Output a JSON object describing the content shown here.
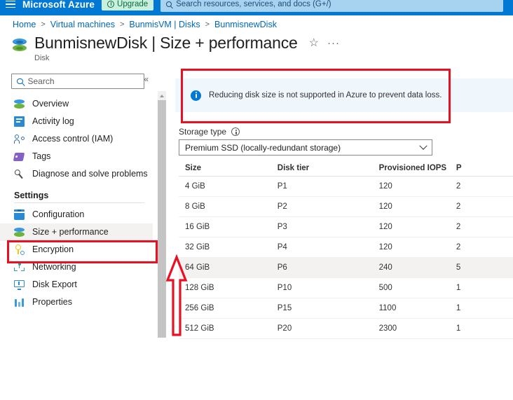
{
  "topbar": {
    "brand": "Microsoft Azure",
    "upgrade_label": "Upgrade",
    "search_placeholder": "Search resources, services, and docs (G+/)",
    "bg_color": "#0078d4",
    "upgrade_bg": "#c8f0dc"
  },
  "breadcrumb": [
    {
      "label": "Home"
    },
    {
      "label": "Virtual machines"
    },
    {
      "label": "BunmisVM | Disks"
    },
    {
      "label": "BunmisnewDisk"
    }
  ],
  "breadcrumb_separator": ">",
  "page": {
    "title": "BunmisnewDisk | Size + performance",
    "subtitle": "Disk",
    "favorite_icon": "☆",
    "more_icon": "···"
  },
  "sidebar": {
    "search_placeholder": "Search",
    "collapse_icon": "«",
    "items": [
      {
        "label": "Overview",
        "icon": "disk-stack-icon",
        "selected": false
      },
      {
        "label": "Activity log",
        "icon": "activity-log-icon",
        "selected": false
      },
      {
        "label": "Access control (IAM)",
        "icon": "access-control-icon",
        "selected": false
      },
      {
        "label": "Tags",
        "icon": "tag-icon",
        "selected": false
      },
      {
        "label": "Diagnose and solve problems",
        "icon": "wrench-icon",
        "selected": false
      }
    ],
    "section_label": "Settings",
    "settings_items": [
      {
        "label": "Configuration",
        "icon": "configuration-icon",
        "selected": false
      },
      {
        "label": "Size + performance",
        "icon": "disk-stack-icon",
        "selected": true
      },
      {
        "label": "Encryption",
        "icon": "key-icon",
        "selected": false
      },
      {
        "label": "Networking",
        "icon": "network-icon",
        "selected": false
      },
      {
        "label": "Disk Export",
        "icon": "export-icon",
        "selected": false
      },
      {
        "label": "Properties",
        "icon": "properties-icon",
        "selected": false
      }
    ]
  },
  "banner": {
    "icon": "info-icon",
    "text": "Reducing disk size is not supported in Azure to prevent data loss.",
    "bg_color": "#eff6fc",
    "icon_color": "#0078d4"
  },
  "storage_type": {
    "label": "Storage type",
    "info_icon": "info-circle-icon",
    "selected_value": "Premium SSD (locally-redundant storage)",
    "chevron_icon": "chevron-down-icon"
  },
  "table": {
    "columns": [
      "Size",
      "Disk tier",
      "Provisioned IOPS",
      "P"
    ],
    "rows": [
      {
        "size": "4 GiB",
        "tier": "P1",
        "iops": "120",
        "throughput": "2",
        "selected": false
      },
      {
        "size": "8 GiB",
        "tier": "P2",
        "iops": "120",
        "throughput": "2",
        "selected": false
      },
      {
        "size": "16 GiB",
        "tier": "P3",
        "iops": "120",
        "throughput": "2",
        "selected": false
      },
      {
        "size": "32 GiB",
        "tier": "P4",
        "iops": "120",
        "throughput": "2",
        "selected": false
      },
      {
        "size": "64 GiB",
        "tier": "P6",
        "iops": "240",
        "throughput": "5",
        "selected": true
      },
      {
        "size": "128 GiB",
        "tier": "P10",
        "iops": "500",
        "throughput": "1",
        "selected": false
      },
      {
        "size": "256 GiB",
        "tier": "P15",
        "iops": "1100",
        "throughput": "1",
        "selected": false
      },
      {
        "size": "512 GiB",
        "tier": "P20",
        "iops": "2300",
        "throughput": "1",
        "selected": false
      }
    ]
  },
  "annotations": {
    "color": "#e81123",
    "boxes": [
      "info-banner-highlight",
      "sidebar-size-performance-highlight"
    ],
    "arrow": "up-arrow-pointing-to-table"
  }
}
